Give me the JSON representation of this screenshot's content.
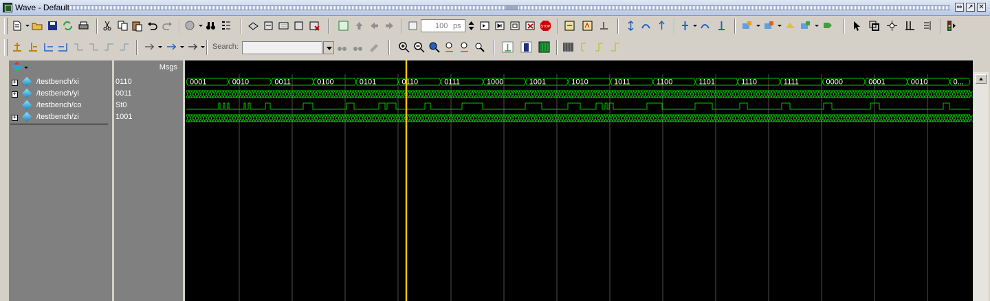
{
  "window": {
    "title": "Wave - Default"
  },
  "toolbar": {
    "zoom_value": "100",
    "zoom_unit": "ps",
    "search_label": "Search:",
    "search_value": ""
  },
  "panes": {
    "values_header": "Msgs"
  },
  "signals": [
    {
      "name": "/testbench/xi",
      "value": "0110",
      "expandable": true
    },
    {
      "name": "/testbench/yi",
      "value": "0011",
      "expandable": true
    },
    {
      "name": "/testbench/co",
      "value": "St0",
      "expandable": false
    },
    {
      "name": "/testbench/zi",
      "value": "1001",
      "expandable": true
    }
  ],
  "xi_bus_labels": [
    "0001",
    "0010",
    "0011",
    "0100",
    "0101",
    "0110",
    "0111",
    "1000",
    "1001",
    "1010",
    "1011",
    "1100",
    "1101",
    "1110",
    "1111",
    "0000",
    "0001",
    "0010",
    "0..."
  ],
  "colors": {
    "wave": "#00c800",
    "cursor": "#ffc800",
    "grid": "#505050",
    "background": "#000000"
  }
}
